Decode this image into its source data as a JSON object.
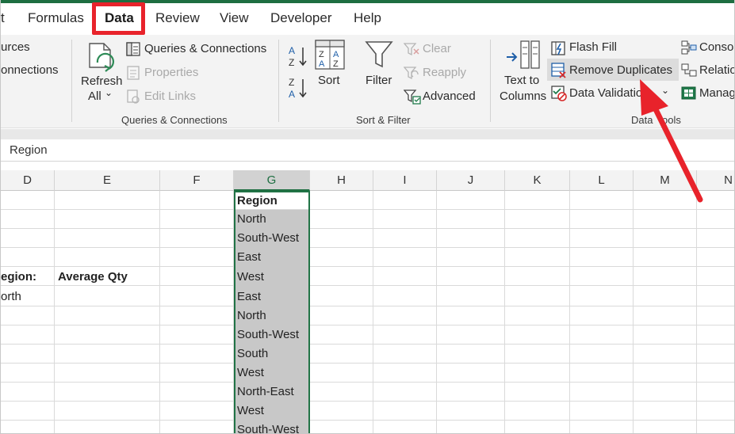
{
  "tabs": [
    {
      "label": "t",
      "active": false
    },
    {
      "label": "Formulas",
      "active": false
    },
    {
      "label": "Data",
      "active": true
    },
    {
      "label": "Review",
      "active": false
    },
    {
      "label": "View",
      "active": false
    },
    {
      "label": "Developer",
      "active": false
    },
    {
      "label": "Help",
      "active": false
    }
  ],
  "ribbon": {
    "get_data": {
      "sources": "urces",
      "connections": "onnections"
    },
    "queries": {
      "refresh": "Refresh",
      "refresh_all": "All",
      "queries_connections": "Queries & Connections",
      "properties": "Properties",
      "edit_links": "Edit Links",
      "group_label": "Queries & Connections"
    },
    "sort_filter": {
      "sort": "Sort",
      "filter": "Filter",
      "clear": "Clear",
      "reapply": "Reapply",
      "advanced": "Advanced",
      "group_label": "Sort & Filter"
    },
    "data_tools": {
      "text_to": "Text to",
      "columns": "Columns",
      "flash_fill": "Flash Fill",
      "remove_duplicates": "Remove Duplicates",
      "data_validation": "Data Validatio",
      "group_label_a": "Data ",
      "group_label_b": "ools"
    },
    "right": {
      "consolidate": "Consol",
      "relationships": "Relatio",
      "manage": "Manag"
    }
  },
  "formula_bar": {
    "value": "Region"
  },
  "columns": [
    "D",
    "E",
    "F",
    "G",
    "H",
    "I",
    "J",
    "K",
    "L",
    "M",
    "N"
  ],
  "cells": {
    "d_region": "egion:",
    "e_avg": "Average Qty",
    "d_north": "orth"
  },
  "column_g": [
    "Region",
    "North",
    "South-West",
    "East",
    "West",
    "East",
    "North",
    "South-West",
    "South",
    "West",
    "North-East",
    "West",
    "South-West"
  ],
  "colors": {
    "accent": "#1e6e41",
    "highlight": "#e8232b"
  }
}
